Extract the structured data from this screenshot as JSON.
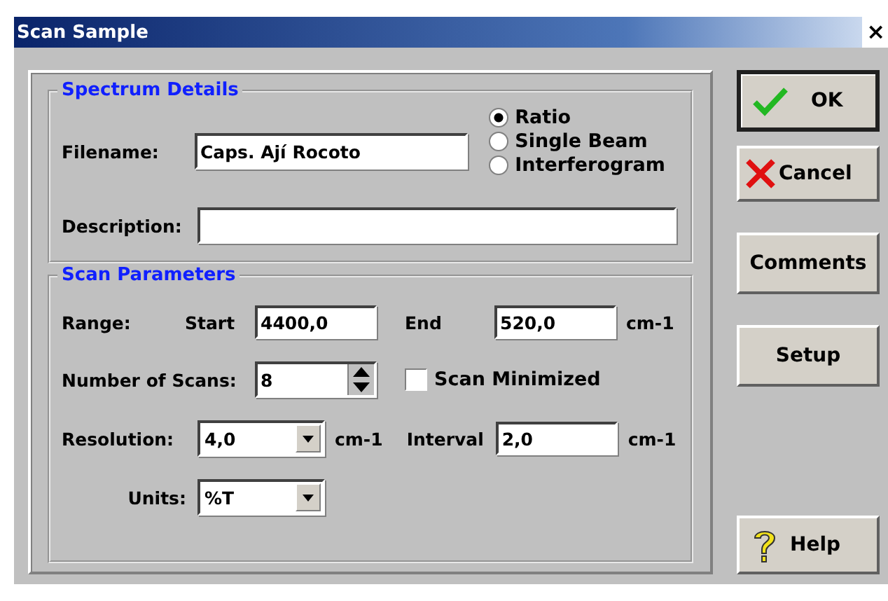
{
  "window": {
    "title": "Scan Sample",
    "close": "×"
  },
  "spectrum_details": {
    "title": "Spectrum Details",
    "filename": {
      "label": "Filename:",
      "value": "Caps. Ají Rocoto"
    },
    "description": {
      "label": "Description:"
    },
    "mode": [
      {
        "label": "Ratio",
        "selected": true
      },
      {
        "label": "Single Beam",
        "selected": false
      },
      {
        "label": "Interferogram",
        "selected": false
      }
    ]
  },
  "scan_parameters": {
    "title": "Scan Parameters",
    "range_label": "Range:",
    "start": {
      "label": "Start",
      "value": "4400,0"
    },
    "end": {
      "label": "End",
      "value": "520,0",
      "unit": "cm-1"
    },
    "scans": {
      "label": "Number of Scans:",
      "value": "8"
    },
    "scan_minimized": {
      "label": "Scan Minimized",
      "checked": false
    },
    "resolution": {
      "label": "Resolution:",
      "value": "4,0",
      "unit": "cm-1"
    },
    "interval": {
      "label": "Interval",
      "value": "2,0",
      "unit": "cm-1"
    },
    "units": {
      "label": "Units:",
      "value": "%T"
    }
  },
  "buttons": [
    {
      "label": "OK",
      "kind": "ok",
      "default": true
    },
    {
      "label": "Cancel",
      "kind": "cancel",
      "default": false
    },
    {
      "label": "Comments",
      "kind": "plain",
      "default": false
    },
    {
      "label": "Setup",
      "kind": "plain",
      "default": false
    },
    {
      "label": "Help",
      "kind": "help",
      "default": false
    }
  ]
}
